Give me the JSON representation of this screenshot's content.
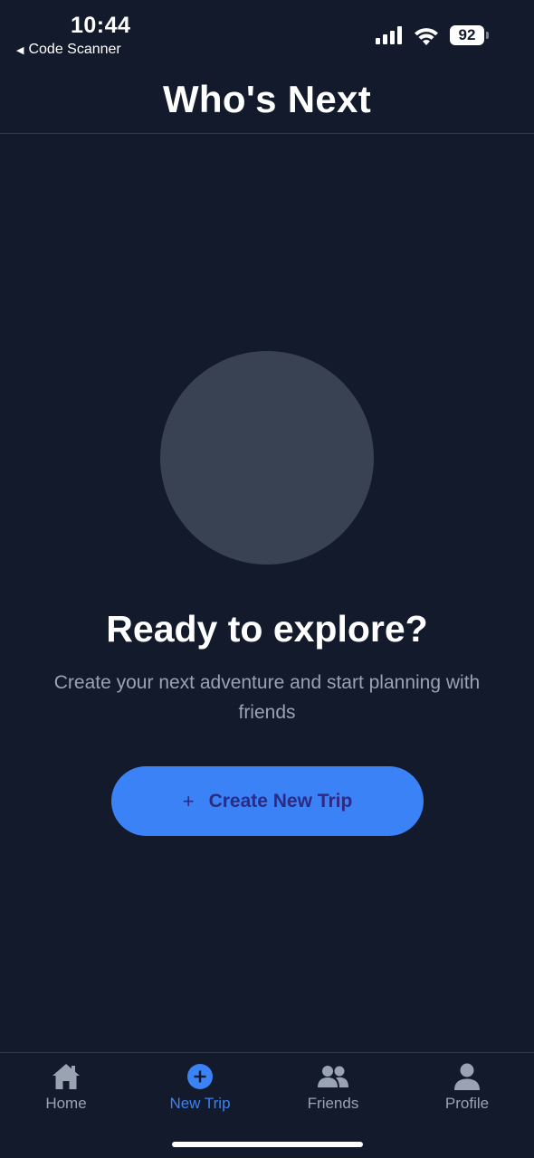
{
  "status_bar": {
    "time": "10:44",
    "back_app": "Code Scanner",
    "battery": "92"
  },
  "header": {
    "title": "Who's Next"
  },
  "empty_state": {
    "title": "Ready to explore?",
    "description": "Create your next adventure and start planning with friends",
    "button_icon": "+",
    "button_label": "Create New Trip"
  },
  "tab_bar": {
    "tabs": [
      {
        "label": "Home",
        "icon": "home-icon",
        "active": false
      },
      {
        "label": "New Trip",
        "icon": "plus-circle-icon",
        "active": true
      },
      {
        "label": "Friends",
        "icon": "friends-icon",
        "active": false
      },
      {
        "label": "Profile",
        "icon": "person-icon",
        "active": false
      }
    ]
  },
  "colors": {
    "background": "#121a2b",
    "accent": "#3b82f6",
    "muted_text": "#9aa3b2",
    "button_text": "#2e2a82",
    "placeholder": "#384253"
  }
}
